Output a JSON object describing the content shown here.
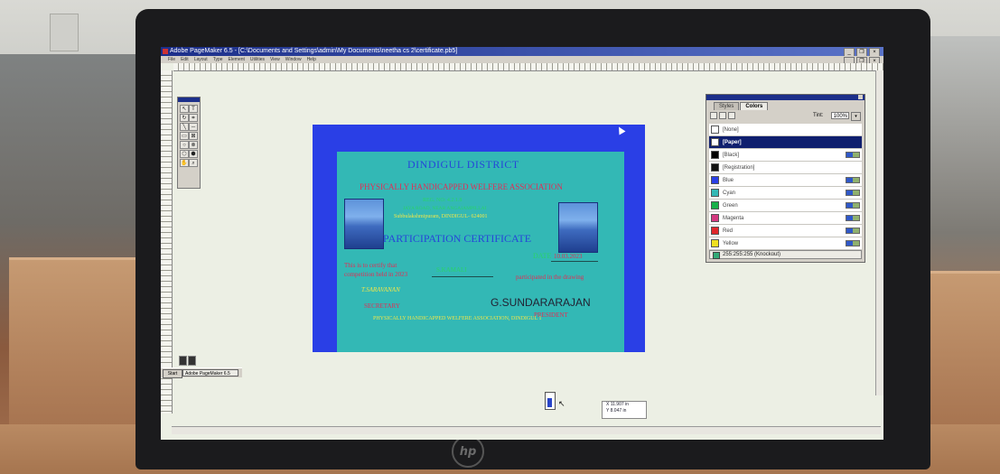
{
  "app": {
    "title": "Adobe PageMaker 6.5 - [C:\\Documents and Settings\\admin\\My Documents\\neetha cs 2\\certificate.pb5]",
    "menus": [
      "File",
      "Edit",
      "Layout",
      "Type",
      "Element",
      "Utilities",
      "View",
      "Window",
      "Help"
    ],
    "window_buttons": [
      "_",
      "❐",
      "×"
    ]
  },
  "certificate": {
    "district": "DINDIGUL DISTRICT",
    "association": "PHYSICALLY HANDICAPPED WELFERE ASSOCIATION",
    "reg": "REG. NO: 4.2.1.8",
    "address1": "JAYA ROAD, NEAR ANGAIAMPILLAI",
    "address2": "Subbulakshmipuram, DINDIGUL- 624001",
    "heading": "PARTICIPATION CERTIFICATE",
    "date_label": "DATE",
    "date_value": "10.03.2023",
    "certify_line1": "This is to certify that",
    "certify_line2": "competition held in 2023",
    "participant_name": "S.KAMALI",
    "drawing_line": "participated in the drawing",
    "signature1": "T.SARAVANAN",
    "signature2": "G.SUNDARARAJAN",
    "secretary": "SECRETARY",
    "president": "PRESIDENT",
    "footer": "PHYSICALLY HANDICAPPED WELFERE ASSOCIATION, DINDIGUL 1"
  },
  "palette": {
    "tabs": [
      "Styles",
      "Colors"
    ],
    "active_tab": "Colors",
    "tint_label": "Tint:",
    "tint_value": "100%",
    "swatches": [
      {
        "label": "[None]",
        "color": "#ffffff",
        "icon": "none-icon"
      },
      {
        "label": "[Paper]",
        "color": "#ffffff",
        "selected": true
      },
      {
        "label": "[Black]",
        "color": "#000000"
      },
      {
        "label": "[Registration]",
        "color": "#111111"
      },
      {
        "label": "Blue",
        "color": "#2a3fe6"
      },
      {
        "label": "Cyan",
        "color": "#33b8b5"
      },
      {
        "label": "Green",
        "color": "#19b04a"
      },
      {
        "label": "Magenta",
        "color": "#d3397f"
      },
      {
        "label": "Red",
        "color": "#e0262b"
      },
      {
        "label": "Yellow",
        "color": "#f0e020"
      }
    ],
    "status": "255:255:255 (Knockout)"
  },
  "taskbar": {
    "start": "Start",
    "task": "Adobe PageMaker 6.5"
  },
  "coords": {
    "x": "X 11.907 in",
    "y": "Y 8.047 in"
  },
  "brand": "hp"
}
